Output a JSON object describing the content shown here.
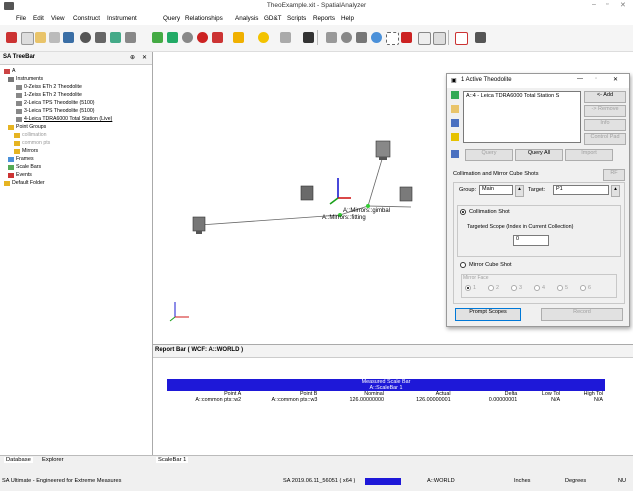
{
  "window": {
    "title": "TheoExample.xit - SpatialAnalyzer"
  },
  "menu": [
    "File",
    "Edit",
    "View",
    "Construct",
    "Instrument",
    "Query",
    "Relationships",
    "Analysis",
    "GD&T",
    "Scripts",
    "Reports",
    "Help"
  ],
  "treebar": {
    "title": "SA TreeBar",
    "root": "A",
    "nodes": [
      {
        "label": "Instruments"
      },
      {
        "label": "0-Zeiss ETh 2 Theodolite"
      },
      {
        "label": "1-Zeiss ETh 2 Theodolite"
      },
      {
        "label": "2-Leica TPS Theodolite (5100)"
      },
      {
        "label": "3-Leica TPS Theodolite (5100)"
      },
      {
        "label": "4-Leica TDRA6000 Total Station (Live)"
      },
      {
        "label": "Point Groups"
      },
      {
        "label": "collimation"
      },
      {
        "label": "common pts"
      },
      {
        "label": "Mirrors"
      },
      {
        "label": "Frames"
      },
      {
        "label": "Scale Bars"
      },
      {
        "label": "Events"
      },
      {
        "label": "Default Folder"
      }
    ],
    "tabs": [
      "Database",
      "Explorer"
    ]
  },
  "viewport": {
    "labels": {
      "fitting": "A::Mirrors::fitting",
      "gimbal": "A::Mirrors::gimbal"
    }
  },
  "dialog": {
    "title": "1 Active Theodolite",
    "instrument": "A::4 - Leica TDRA6000 Total Station  S",
    "buttons": {
      "add": "<- Add",
      "remove": "-> Remove",
      "info": "Info",
      "control_pad": "Control Pad",
      "query": "Query",
      "query_all": "Query All",
      "import": "Import",
      "rf": "RF",
      "prompt_scopes": "Prompt Scopes",
      "record": "Record"
    },
    "section_title": "Collimation and Mirror Cube Shots",
    "group_label": "Group:",
    "group_value": "Main",
    "target_label": "Target:",
    "target_value": "P1",
    "collimation_label": "Collimation Shot",
    "scope_label": "Targeted Scope (Index in Current Collection)",
    "scope_value": "0",
    "mirror_label": "Mirror Cube Shot",
    "mirror_face_label": "Mirror Face",
    "faces": [
      "1",
      "2",
      "3",
      "4",
      "5",
      "6"
    ]
  },
  "report": {
    "title": "Report Bar  ( WCF: A::WORLD )",
    "table_title": "Measured Scale Bar",
    "table_subtitle": "A::ScaleBar 1",
    "columns": [
      "Point A",
      "Point B",
      "Nominal",
      "Actual",
      "Delta",
      "Low Tol",
      "High Tol"
    ],
    "row": [
      "A::common pts::w2",
      "A::common pts::w3",
      "126.00000000",
      "126.00000001",
      "0.00000001",
      "N/A",
      "N/A"
    ],
    "tab": "ScaleBar 1"
  },
  "status": {
    "left": "SA Ultimate - Engineered for Extreme Measures",
    "version": "SA 2019.06.11_56051 ( x64 )",
    "frame": "A::WORLD",
    "units_length": "Inches",
    "units_angle": "Degrees",
    "mode": "NU"
  }
}
